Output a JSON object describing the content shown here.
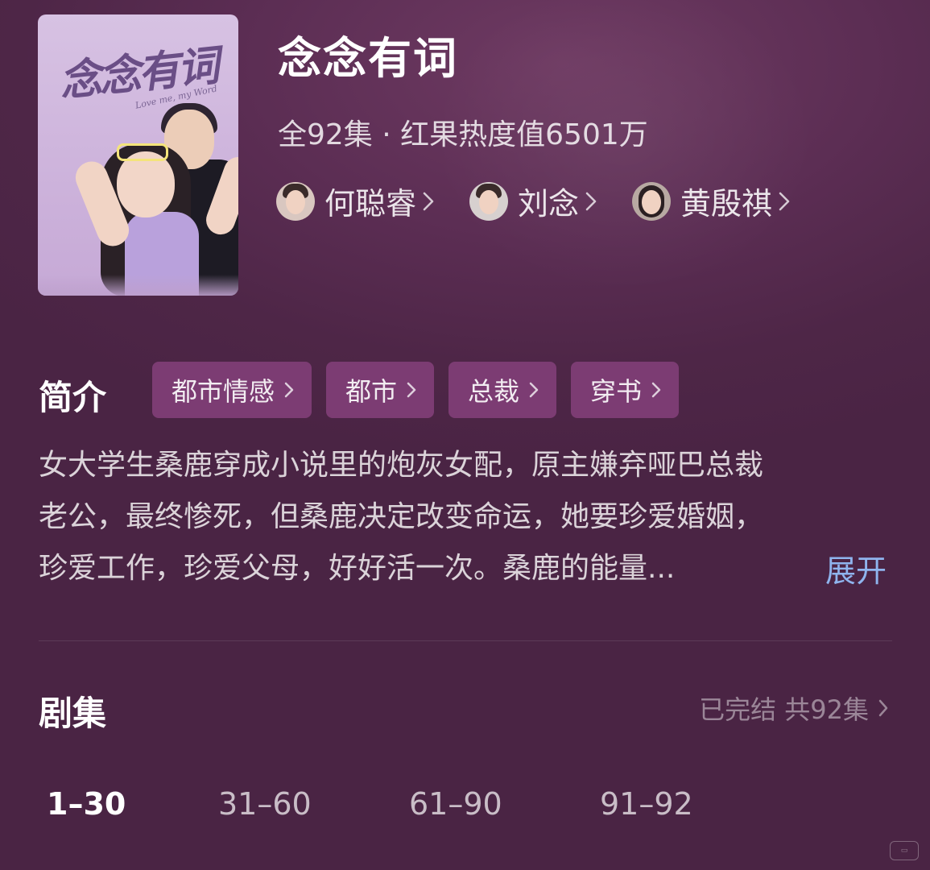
{
  "show": {
    "title": "念念有词",
    "meta": "全92集 · 红果热度值6501万",
    "poster": {
      "title_art": "念念有词",
      "subtitle_art": "Love me, my Word"
    }
  },
  "cast": [
    {
      "name": "何聪睿"
    },
    {
      "name": "刘念"
    },
    {
      "name": "黄殷祺"
    }
  ],
  "synopsis": {
    "title": "简介",
    "tags": [
      "都市情感",
      "都市",
      "总裁",
      "穿书"
    ],
    "lines": [
      "女大学生桑鹿穿成小说里的炮灰女配，原主嫌弃哑巴总裁",
      "老公，最终惨死，但桑鹿决定改变命运，她要珍爱婚姻，",
      "珍爱工作，珍爱父母，好好活一次。桑鹿的能量..."
    ],
    "expand_label": "展开"
  },
  "episodes": {
    "title": "剧集",
    "status": "已完结 共92集",
    "ranges": [
      "1–30",
      "31–60",
      "61–90",
      "91–92"
    ],
    "active_index": 0
  },
  "colors": {
    "background": "#552a4d",
    "tag_bg": "#7c3c73",
    "link": "#8fb4ee"
  },
  "icons": [
    "chevron-right-icon"
  ]
}
